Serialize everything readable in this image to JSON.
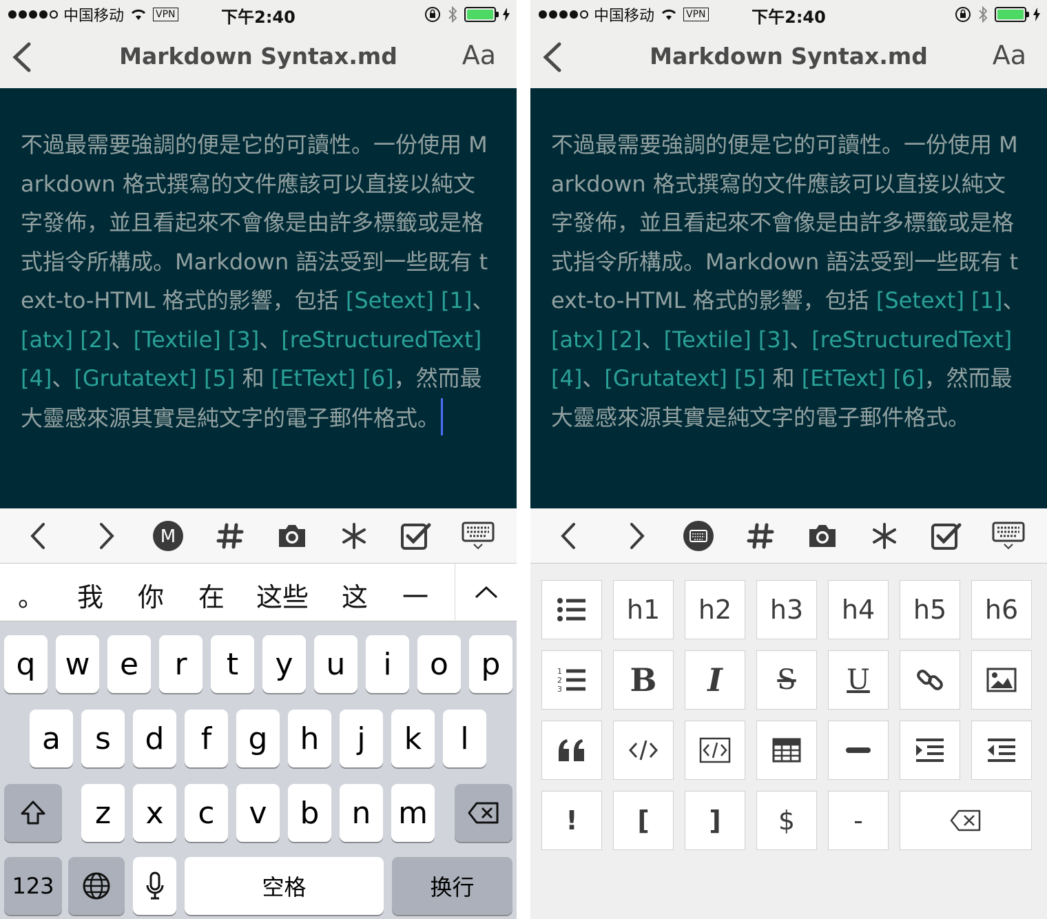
{
  "status": {
    "carrier": "中国移动",
    "vpn": "VPN",
    "time": "下午2:40",
    "signal_bars": 4
  },
  "nav": {
    "title": "Markdown Syntax.md",
    "font_label": "Aa"
  },
  "editor": {
    "segments": [
      {
        "text": "不過最需要強調的便是它的可讀性。一份使用 Markdown 格式撰寫的文件應該可以直接以純文字發佈，並且看起來不會像是由許多標籤或是格式指令所構成。Markdown 語法受到一些既有 text-to-HTML 格式的影響，包括 ",
        "link": false
      },
      {
        "text": "[Setext] [1]",
        "link": true
      },
      {
        "text": "、",
        "link": false
      },
      {
        "text": "[atx] [2]",
        "link": true
      },
      {
        "text": "、",
        "link": false
      },
      {
        "text": "[Textile] [3]",
        "link": true
      },
      {
        "text": "、",
        "link": false
      },
      {
        "text": "[reStructuredText] [4]",
        "link": true
      },
      {
        "text": "、",
        "link": false
      },
      {
        "text": "[Grutatext] [5]",
        "link": true
      },
      {
        "text": " 和 ",
        "link": false
      },
      {
        "text": "[EtText] [6]",
        "link": true
      },
      {
        "text": "，然而最大靈感來源其實是純文字的電子郵件格式。",
        "link": false
      }
    ]
  },
  "candidates": [
    "。",
    "我",
    "你",
    "在",
    "这些",
    "这",
    "一"
  ],
  "keyboard": {
    "row1": [
      "q",
      "w",
      "e",
      "r",
      "t",
      "y",
      "u",
      "i",
      "o",
      "p"
    ],
    "row2": [
      "a",
      "s",
      "d",
      "f",
      "g",
      "h",
      "j",
      "k",
      "l"
    ],
    "row3": [
      "z",
      "x",
      "c",
      "v",
      "b",
      "n",
      "m"
    ],
    "numbers_label": "123",
    "space_label": "空格",
    "return_label": "换行"
  },
  "format_panel": {
    "headings": [
      "h1",
      "h2",
      "h3",
      "h4",
      "h5",
      "h6"
    ],
    "bold": "B",
    "italic": "I",
    "underline": "U",
    "strikethrough": "S",
    "symbols": [
      "!",
      "[",
      "]",
      "$",
      "-"
    ]
  },
  "colors": {
    "editor_bg": "#002b36",
    "editor_text": "#93a1a1",
    "link_text": "#2aa198",
    "cursor": "#4c6ef5",
    "battery": "#4cd964"
  }
}
